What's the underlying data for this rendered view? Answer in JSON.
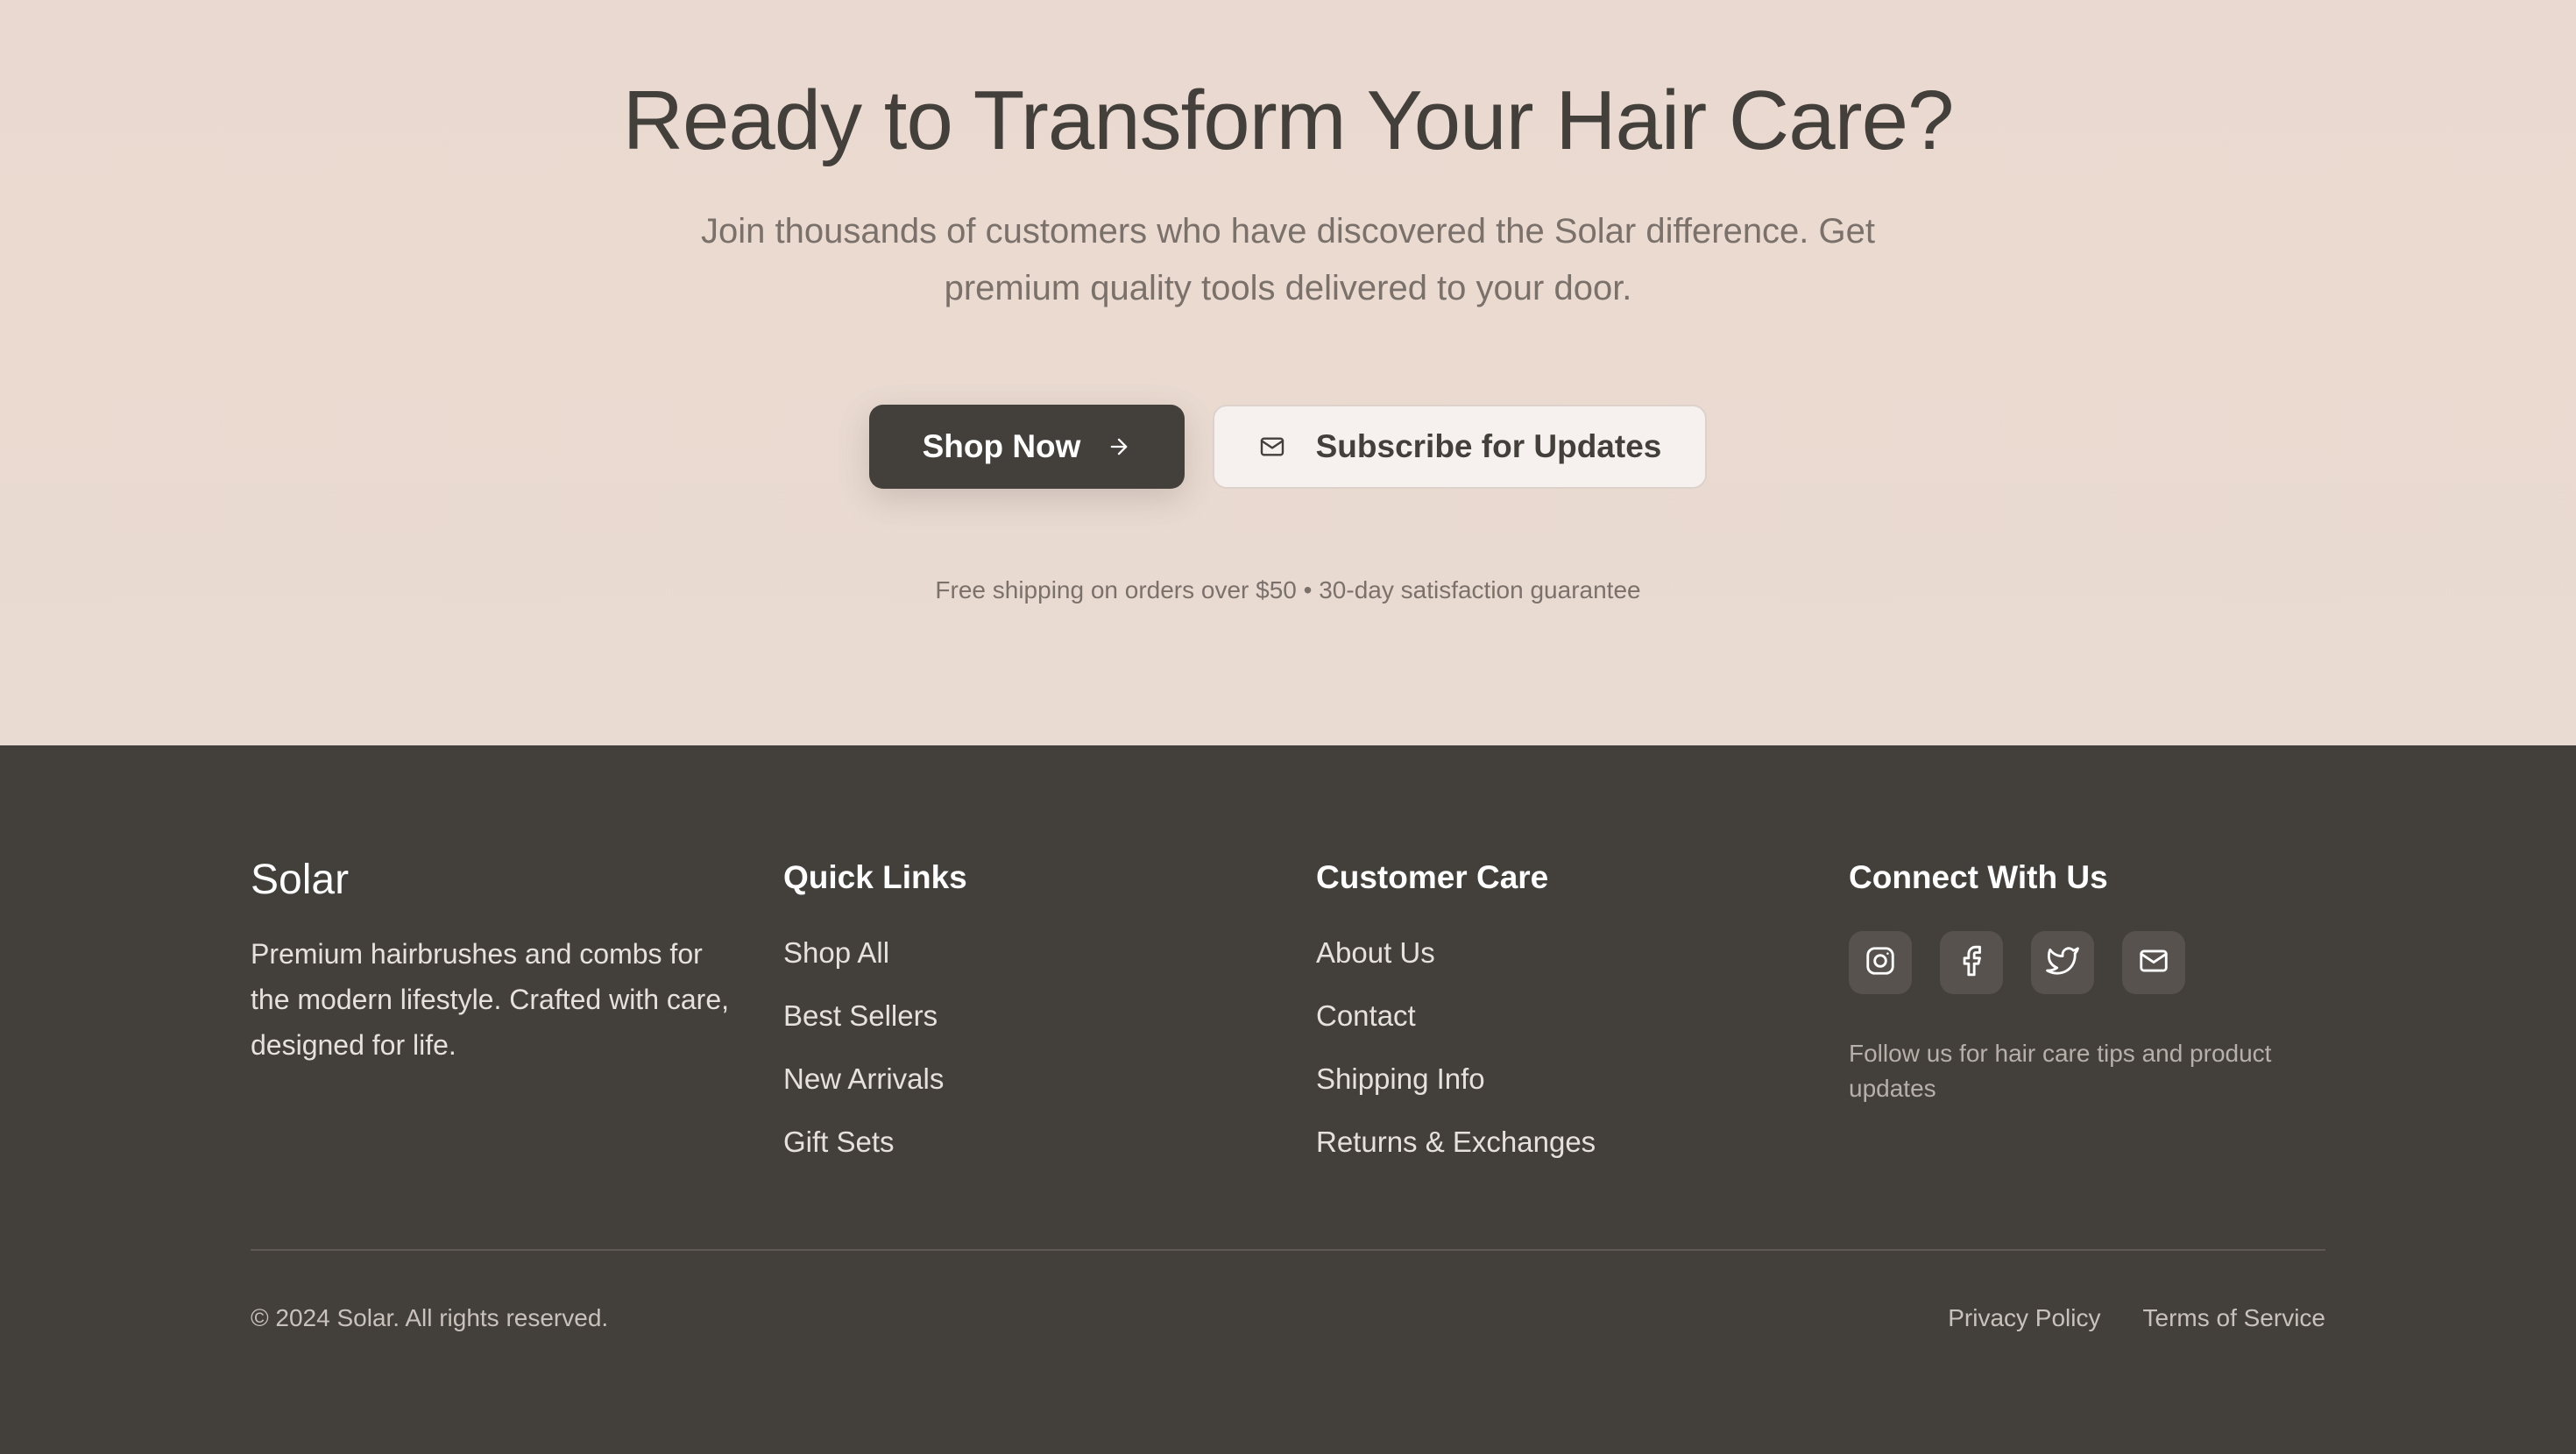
{
  "cta": {
    "title": "Ready to Transform Your Hair Care?",
    "subtitle": "Join thousands of customers who have discovered the Solar difference. Get premium quality tools delivered to your door.",
    "primary_button": {
      "label": "Shop Now",
      "icon": "arrow-right-icon"
    },
    "secondary_button": {
      "label": "Subscribe for Updates",
      "icon": "mail-icon"
    },
    "note": "Free shipping on orders over $50 • 30-day satisfaction guarantee"
  },
  "footer": {
    "brand": {
      "name": "Solar",
      "description": "Premium hairbrushes and combs for the modern lifestyle. Crafted with care, designed for life."
    },
    "quick_links": {
      "heading": "Quick Links",
      "items": [
        "Shop All",
        "Best Sellers",
        "New Arrivals",
        "Gift Sets"
      ]
    },
    "customer_care": {
      "heading": "Customer Care",
      "items": [
        "About Us",
        "Contact",
        "Shipping Info",
        "Returns & Exchanges"
      ]
    },
    "connect": {
      "heading": "Connect With Us",
      "socials": [
        "instagram-icon",
        "facebook-icon",
        "twitter-icon",
        "mail-icon"
      ],
      "follow_text": "Follow us for hair care tips and product updates"
    },
    "copyright": "© 2024 Solar. All rights reserved.",
    "legal": {
      "privacy": "Privacy Policy",
      "terms": "Terms of Service"
    }
  },
  "colors": {
    "cta_background": "#eadad1",
    "footer_background": "#433f3b",
    "primary_button": "#433f3b",
    "secondary_button": "#f6f1ee",
    "heading_text": "#433f3b",
    "muted_text": "#7b716b"
  }
}
